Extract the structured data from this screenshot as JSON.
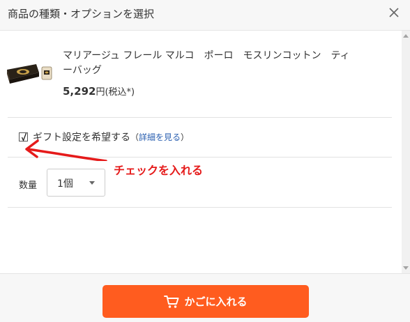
{
  "header": {
    "title": "商品の種類・オプションを選択",
    "close_icon": "close-icon"
  },
  "product": {
    "name": "マリアージュ フレール マルコ　ポーロ　モスリンコットン　ティーバッグ",
    "price_value": "5,292",
    "price_unit": "円(税込*)",
    "image": "product-thumbnail"
  },
  "gift": {
    "checked": true,
    "label": "ギフト設定を希望する",
    "paren_open": "（",
    "link_label": "詳細を見る",
    "paren_close": "）"
  },
  "annotation": {
    "text": "チェックを入れる",
    "color": "#e51a1a"
  },
  "quantity": {
    "label": "数量",
    "selected": "1個"
  },
  "footer": {
    "cart_button_label": "かごに入れる",
    "cart_icon": "cart-icon",
    "button_color": "#ff5c1f"
  }
}
